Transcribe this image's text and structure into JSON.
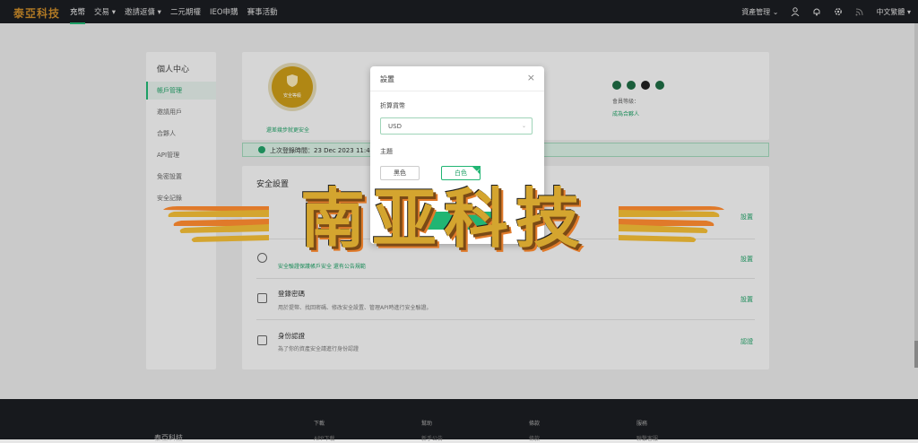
{
  "topbar": {
    "logo": "泰亞科技",
    "nav": [
      "充幣",
      "交易 ▾",
      "邀請返傭 ▾",
      "二元期權",
      "IEO申購",
      "賽事活動"
    ],
    "asset_management": "資產管理 ⌄",
    "language": "中文繁體"
  },
  "sidebar": {
    "title": "個人中心",
    "items": [
      "帳戶管理",
      "邀請用戶",
      "合夥人",
      "API管理",
      "免密設置",
      "安全記錄"
    ]
  },
  "account": {
    "badge_text": "安全等級",
    "badge_link": "還差幾步就更安全",
    "member_level": "會員等級：",
    "invite_link": "成為合夥人"
  },
  "login_bar": {
    "text": "上次登錄時間：23 Dec 2023 11:4"
  },
  "security": {
    "title": "安全設置",
    "rows": [
      {
        "name": "",
        "desc": "",
        "link": "設置"
      },
      {
        "name": "",
        "desc": "",
        "link": "設置"
      },
      {
        "name": "登錄密碼",
        "desc": "用於提幣、找回密碼、修改安全設置、管理API時進行安全驗證。",
        "link": "設置"
      },
      {
        "name": "身份認證",
        "desc": "為了你的資產安全請進行身份認證",
        "link": "認證"
      }
    ],
    "row2_sub": "安全驗證保護帳戶安全  還有公告規範"
  },
  "footer": {
    "brand": "泰亞科技",
    "columns": [
      "下載",
      "幫助",
      "條款",
      "服務"
    ],
    "subs": [
      "APP下載",
      "新手公告",
      "條款",
      "聯繫客服"
    ]
  },
  "modal": {
    "title": "設置",
    "close": "×",
    "currency_label": "折算貨幣",
    "currency_value": "USD",
    "theme_label": "主題",
    "theme_dark": "黑色",
    "theme_light": "白色",
    "confirm": "確定"
  },
  "watermark": {
    "text": "南亚科技"
  },
  "colors": {
    "accent": "#21b573",
    "topbar": "#1b1d22",
    "gold": "#d4a52f"
  }
}
